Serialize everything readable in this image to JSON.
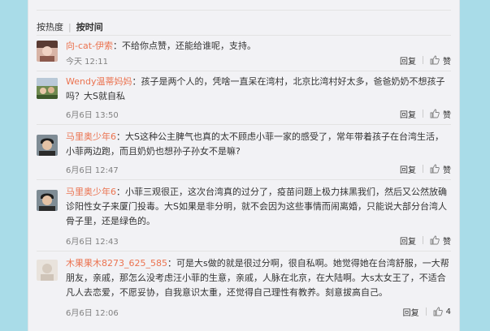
{
  "sort": {
    "hot": "按热度",
    "separator": "|",
    "time": "按时间"
  },
  "comments": [
    {
      "user": "向-cat-伊索",
      "text": "不给你点赞，还能给谁呢，支持。",
      "time": "今天 12:11",
      "reply": "回复",
      "like": "赞"
    },
    {
      "user": "Wendy温蒂妈妈",
      "text": "孩子是两个人的，凭啥一直呆在湾村，北京比湾村好太多，爸爸奶奶不想孩子吗？大S就自私",
      "time": "6月6日 13:50",
      "reply": "回复",
      "like": "赞"
    },
    {
      "user": "马里奥少年6",
      "text": "大S这种公主脾气也真的太不顾虑小菲一家的感受了，常年带着孩子在台湾生活，小菲两边跑，而且奶奶也想孙子孙女不是嘛?",
      "time": "6月6日 12:47",
      "reply": "回复",
      "like": "赞"
    },
    {
      "user": "马里奥少年6",
      "text": "小菲三观很正，这次台湾真的过分了，疫苗问题上极力抹黑我们，然后又公然放确诊阳性女子来厦门投毒。大S如果是非分明，就不会因为这些事情而闹离婚，只能说大部分台湾人骨子里，还是绿色的。",
      "time": "6月6日 12:43",
      "reply": "回复",
      "like": "赞"
    },
    {
      "user": "木果果木8273_625_585",
      "text": "可是大s做的就是很过分啊，很自私啊。她觉得她在台湾舒服，一大帮朋友，亲戚，那怎么没考虑汪小菲的生意，亲戚，人脉在北京，在大陆啊。大s太女王了，不适合凡人去恋爱，不愿妥协，自我意识太重，还觉得自己理性有教养。刻意拔高自己。",
      "time": "6月6日 12:06",
      "reply": "回复",
      "like": "4"
    }
  ],
  "colors": {
    "background": "#a9dce8",
    "panel": "#f2f2f5",
    "username": "#eb7350"
  },
  "icons": {
    "like": "thumbs-up-icon"
  }
}
